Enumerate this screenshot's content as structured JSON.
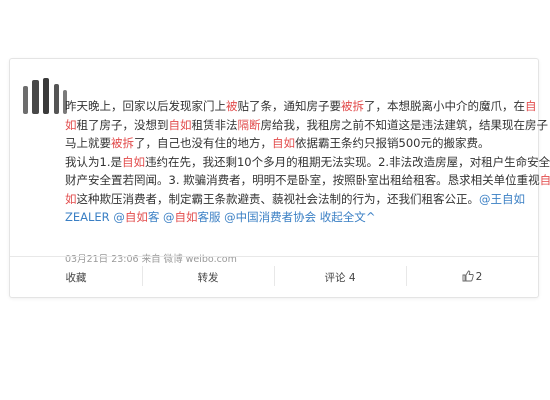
{
  "post": {
    "lines": [
      [
        {
          "t": "昨天晚上，回家以后发现家门上",
          "c": ""
        },
        {
          "t": "被",
          "c": "red"
        },
        {
          "t": "贴了条，通知房子要",
          "c": ""
        },
        {
          "t": "被拆",
          "c": "red"
        },
        {
          "t": "了，本想脱离小中介的魔爪，在",
          "c": ""
        },
        {
          "t": "自",
          "c": "red"
        }
      ],
      [
        {
          "t": "如",
          "c": "red"
        },
        {
          "t": "租了房子，没想到",
          "c": ""
        },
        {
          "t": "自如",
          "c": "red"
        },
        {
          "t": "租赁非法",
          "c": ""
        },
        {
          "t": "隔断",
          "c": "red"
        },
        {
          "t": "房给我，我租房之前不知道这是违法建筑，结果现在房子",
          "c": ""
        }
      ],
      [
        {
          "t": "马上就要",
          "c": ""
        },
        {
          "t": "被拆",
          "c": "red"
        },
        {
          "t": "了，自己也没有住的地方，",
          "c": ""
        },
        {
          "t": "自如",
          "c": "red"
        },
        {
          "t": "依据霸王条约只报销500元的搬家费。",
          "c": ""
        }
      ],
      [
        {
          "t": "我认为1.是",
          "c": ""
        },
        {
          "t": "自如",
          "c": "red"
        },
        {
          "t": "违约在先，我还剩10个多月的租期无法实现。2.非法改造房屋，对租户生命安全",
          "c": ""
        }
      ],
      [
        {
          "t": "财产安全置若罔闻。3. 欺骗消费者，明明不是卧室，按照卧室出租给租客。恳求相关单位重视",
          "c": ""
        },
        {
          "t": "自",
          "c": "red"
        }
      ],
      [
        {
          "t": "如",
          "c": "red"
        },
        {
          "t": "这种欺压消费者，制定霸王条款避责、藐视社会法制的行为，还我们租客公正。",
          "c": ""
        },
        {
          "t": "@王自如",
          "c": "blue"
        }
      ],
      [
        {
          "t": "ZEALER @",
          "c": "blue"
        },
        {
          "t": "自如",
          "c": "red"
        },
        {
          "t": "客 @",
          "c": "blue"
        },
        {
          "t": "自如",
          "c": "red"
        },
        {
          "t": "客服 @中国消费者协会 收起全文",
          "c": "blue"
        },
        {
          "t": "^",
          "c": "blue"
        }
      ]
    ],
    "meta": "03月21日 23:06 来自 微博 weibo.com"
  },
  "actions": {
    "favorite": "收藏",
    "repost": "转发",
    "comment": "评论 4",
    "like_count": "2"
  },
  "colors": {
    "mention": "#3a7fc4",
    "keyword": "#e24c4c"
  }
}
